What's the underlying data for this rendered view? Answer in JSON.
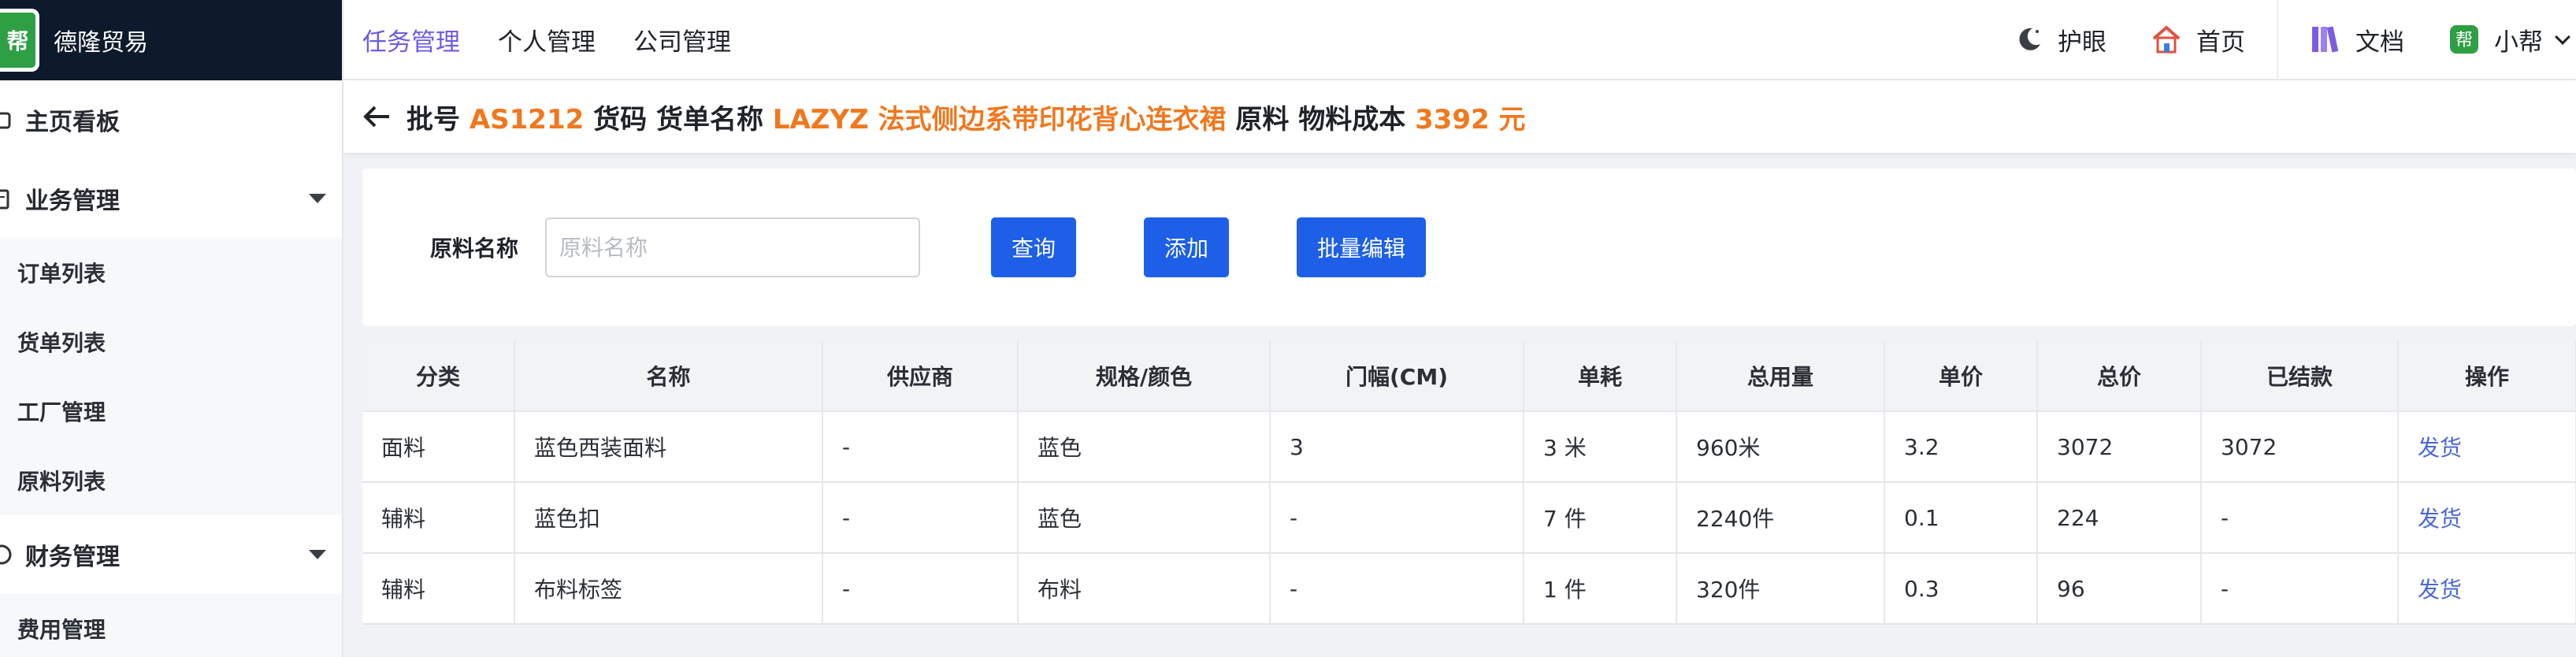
{
  "brand": {
    "name": "德隆贸易",
    "logo_text": "帮"
  },
  "sidebar": {
    "home": "主页看板",
    "groups": [
      {
        "label": "业务管理",
        "items": [
          "订单列表",
          "货单列表",
          "工厂管理",
          "原料列表"
        ]
      },
      {
        "label": "财务管理",
        "items": [
          "费用管理"
        ]
      }
    ]
  },
  "topnav": {
    "items": [
      "任务管理",
      "个人管理",
      "公司管理"
    ],
    "active_index": 0
  },
  "topright": {
    "eye": "护眼",
    "home": "首页",
    "docs": "文档",
    "user": "小帮",
    "badge": "帮"
  },
  "header": {
    "batch_label": "批号",
    "batch_value": "AS1212",
    "code_label": "货码",
    "name_label": "货单名称",
    "name_value": "LAZYZ 法式侧边系带印花背心连衣裙",
    "material_label": "原料",
    "cost_label": "物料成本",
    "cost_value": "3392 元"
  },
  "search": {
    "label": "原料名称",
    "placeholder": "原料名称",
    "value": "",
    "query": "查询",
    "add": "添加",
    "batch_edit": "批量编辑"
  },
  "table": {
    "columns": [
      "分类",
      "名称",
      "供应商",
      "规格/颜色",
      "门幅(CM)",
      "单耗",
      "总用量",
      "单价",
      "总价",
      "已结款",
      "操作"
    ],
    "rows": [
      [
        "面料",
        "蓝色西装面料",
        "-",
        "蓝色",
        "3",
        "3 米",
        "960米",
        "3.2",
        "3072",
        "3072",
        "发货"
      ],
      [
        "辅料",
        "蓝色扣",
        "-",
        "蓝色",
        "-",
        "7 件",
        "2240件",
        "0.1",
        "224",
        "-",
        "发货"
      ],
      [
        "辅料",
        "布料标签",
        "-",
        "布料",
        "-",
        "1 件",
        "320件",
        "0.3",
        "96",
        "-",
        "发货"
      ]
    ]
  },
  "colors": {
    "accent": "#6b5ce7",
    "primary": "#1d5fe6",
    "highlight": "#f0781e",
    "sidebar_dark": "#0d1a2b",
    "link": "#4a67d6"
  }
}
